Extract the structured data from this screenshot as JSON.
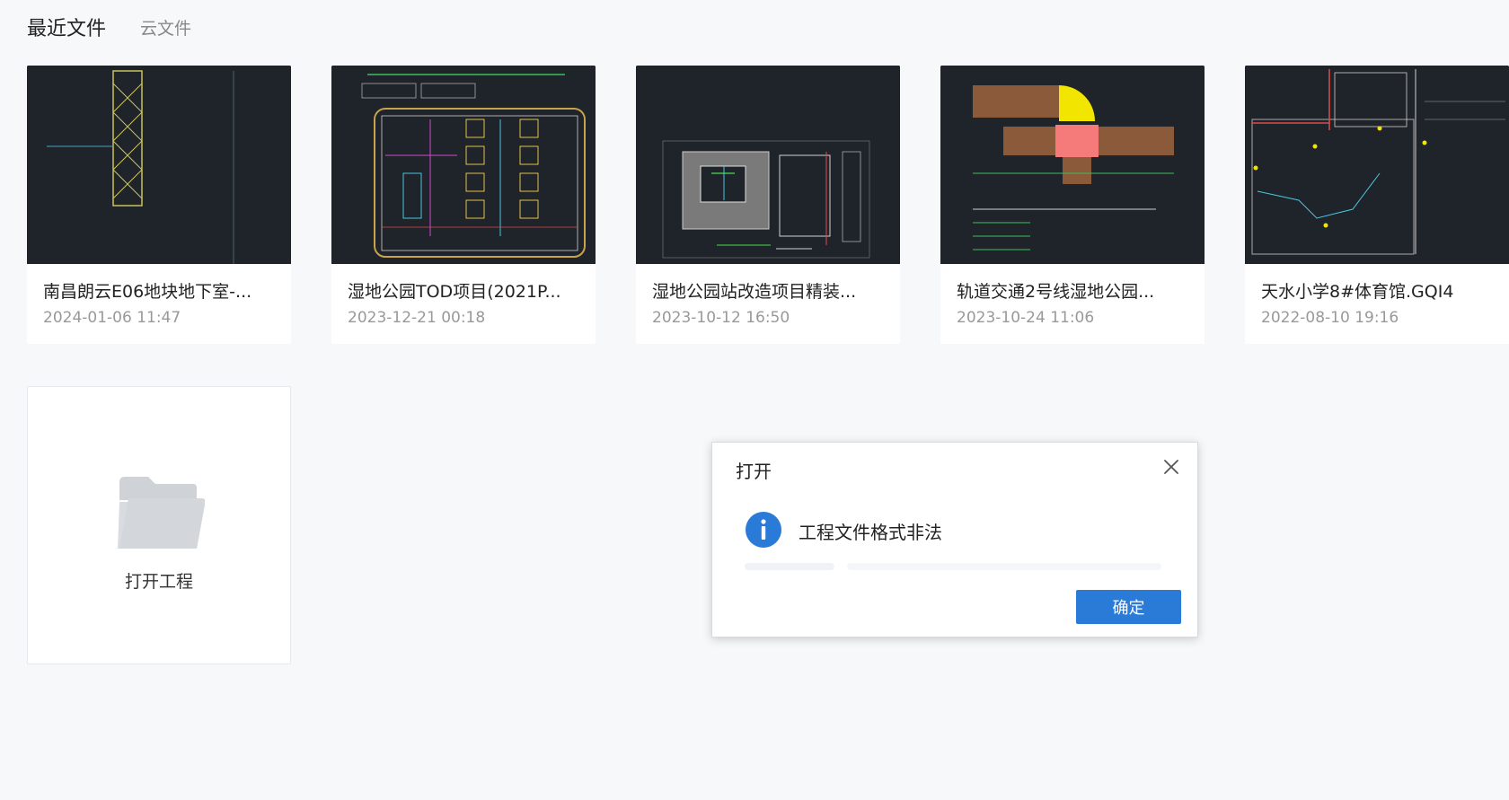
{
  "tabs": {
    "recent": "最近文件",
    "cloud": "云文件"
  },
  "recent_files": [
    {
      "name": "南昌朗云E06地块地下室-...",
      "date": "2024-01-06 11:47"
    },
    {
      "name": "湿地公园TOD项目(2021P...",
      "date": "2023-12-21 00:18"
    },
    {
      "name": "湿地公园站改造项目精装...",
      "date": "2023-10-12 16:50"
    },
    {
      "name": "轨道交通2号线湿地公园...",
      "date": "2023-10-24 11:06"
    },
    {
      "name": "天水小学8#体育馆.GQI4",
      "date": "2022-08-10 19:16"
    }
  ],
  "open_project": {
    "label": "打开工程",
    "icon": "folder-icon"
  },
  "dialog": {
    "title": "打开",
    "message": "工程文件格式非法",
    "icon": "info-icon",
    "ok_label": "确定"
  },
  "colors": {
    "accent": "#2a7ad7",
    "thumbnail_bg": "#1f232a",
    "page_bg": "#f7f8fa",
    "folder": "#d3d7dc"
  }
}
